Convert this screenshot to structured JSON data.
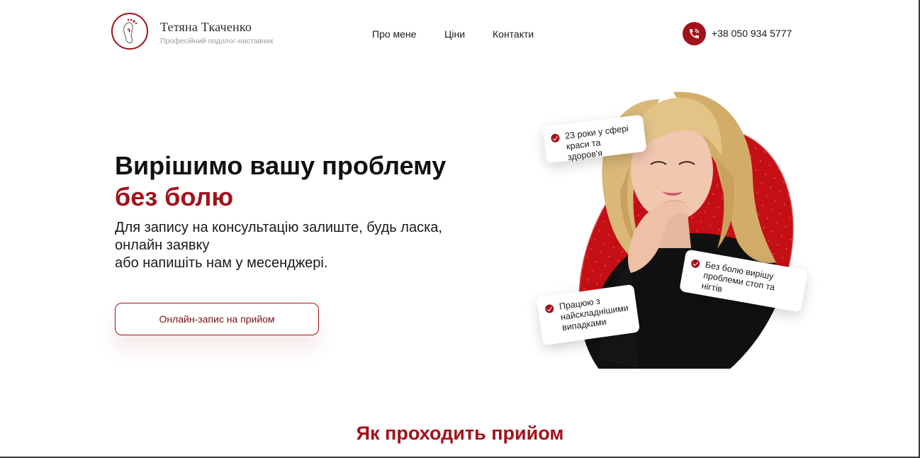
{
  "brand": {
    "name": "Тетяна Ткаченко",
    "subtitle": "Професійний подолог-наставник",
    "color": "#a3121b"
  },
  "nav": {
    "items": [
      {
        "label": "Про мене"
      },
      {
        "label": "Ціни"
      },
      {
        "label": "Контакти"
      }
    ]
  },
  "contact": {
    "icon": "phone-icon",
    "phone": "+38 050 934 5777"
  },
  "hero": {
    "title": "Вирішимо вашу проблему",
    "title_accent": "без болю",
    "subtitle_lines": [
      "Для запису на консультацію залиште, будь ласка,",
      "онлайн заявку",
      "або напишіть нам у месенджері."
    ],
    "cta_label": "Онлайн-запис на прийом"
  },
  "badges": [
    {
      "lines": [
        "23 роки у сфері",
        "краси та здоров'я"
      ]
    },
    {
      "lines": [
        "Без болю вирішу",
        "проблеми стоп та",
        "нігтів"
      ]
    },
    {
      "lines": [
        "Працюю з",
        "найскладнішими",
        "випадками"
      ]
    }
  ],
  "section": {
    "title": "Як проходить прийом"
  }
}
